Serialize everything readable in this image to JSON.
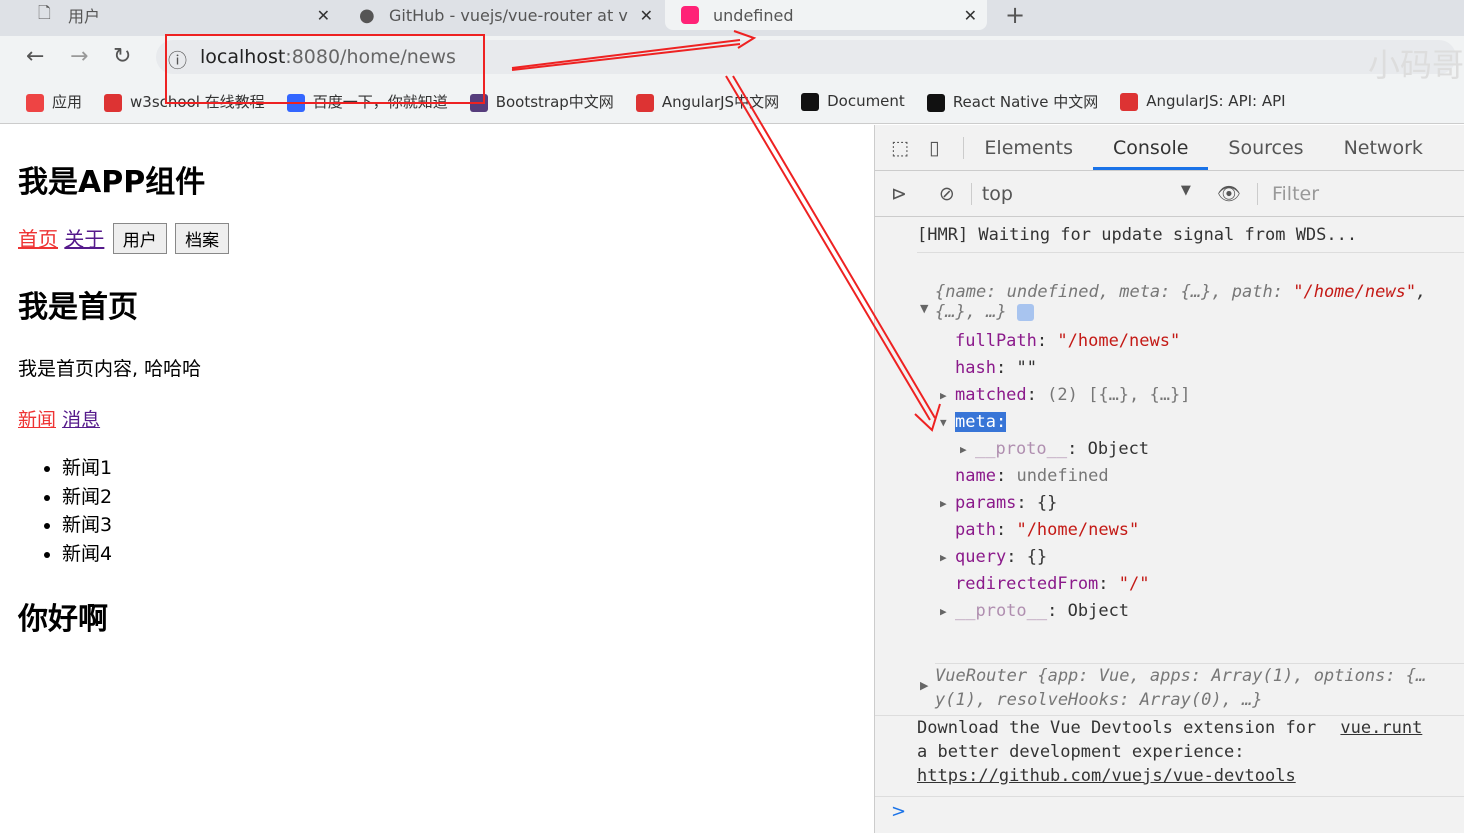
{
  "tabs": [
    {
      "title": "用户"
    },
    {
      "title": "GitHub - vuejs/vue-router at v"
    },
    {
      "title": "undefined"
    }
  ],
  "new_tab": "+",
  "address": {
    "host": "localhost",
    "rest": ":8080/home/news"
  },
  "watermark": "小码哥",
  "bookmarks": [
    {
      "label": "应用",
      "color": "#e44"
    },
    {
      "label": "w3school 在线教程",
      "color": "#d33"
    },
    {
      "label": "百度一下，你就知道",
      "color": "#36f"
    },
    {
      "label": "Bootstrap中文网",
      "color": "#563d7c"
    },
    {
      "label": "AngularJS中文网",
      "color": "#d33"
    },
    {
      "label": "Document",
      "color": "#111"
    },
    {
      "label": "React Native 中文网",
      "color": "#111"
    },
    {
      "label": "AngularJS: API: API",
      "color": "#d33"
    }
  ],
  "page": {
    "h_app": "我是APP组件",
    "links": [
      "首页",
      "关于"
    ],
    "buttons": [
      "用户",
      "档案"
    ],
    "h_home": "我是首页",
    "content": "我是首页内容, 哈哈哈",
    "sublinks": [
      "新闻",
      "消息"
    ],
    "news": [
      "新闻1",
      "新闻2",
      "新闻3",
      "新闻4"
    ],
    "h_hello": "你好啊"
  },
  "devtools": {
    "tabs": [
      "Elements",
      "Console",
      "Sources",
      "Network"
    ],
    "active_tab": "Console",
    "context": "top",
    "filter_placeholder": "Filter",
    "hmr": "[HMR] Waiting for update signal from WDS...",
    "obj_summary1": "{name: undefined, meta: {…}, path: ",
    "obj_summary_path": "\"/home/news\"",
    "obj_summary_comma": ",",
    "obj_summary2": "{…}, …}",
    "props": [
      {
        "k": "fullPath",
        "v": "\"/home/news\"",
        "str": true,
        "arrow": false
      },
      {
        "k": "hash",
        "v": "\"\"",
        "str": false,
        "arrow": false
      },
      {
        "k": "matched",
        "v": "(2) [{…}, {…}]",
        "str": false,
        "arrow": true
      },
      {
        "k": "meta",
        "v": "",
        "str": false,
        "arrow": true
      },
      {
        "k": "__proto__",
        "v": "Object",
        "str": false,
        "arrow": true
      },
      {
        "k": "name",
        "v": "undefined",
        "str": false,
        "arrow": false
      },
      {
        "k": "params",
        "v": "{}",
        "str": false,
        "arrow": true
      },
      {
        "k": "path",
        "v": "\"/home/news\"",
        "str": true,
        "arrow": false
      },
      {
        "k": "query",
        "v": "{}",
        "str": false,
        "arrow": true
      },
      {
        "k": "redirectedFrom",
        "v": "\"/\"",
        "str": true,
        "arrow": false
      },
      {
        "k": "__proto__",
        "v": "Object",
        "str": false,
        "arrow": true
      }
    ],
    "router1": "VueRouter {app: Vue, apps: Array(1), options: {…",
    "router2": "y(1), resolveHooks: Array(0), …}",
    "dl1": "Download the Vue Devtools extension for",
    "dl2": "a better development experience:",
    "dl_link": "https://github.com/vuejs/vue-devtools",
    "dl_src": "vue.runt",
    "prompt": ">"
  }
}
